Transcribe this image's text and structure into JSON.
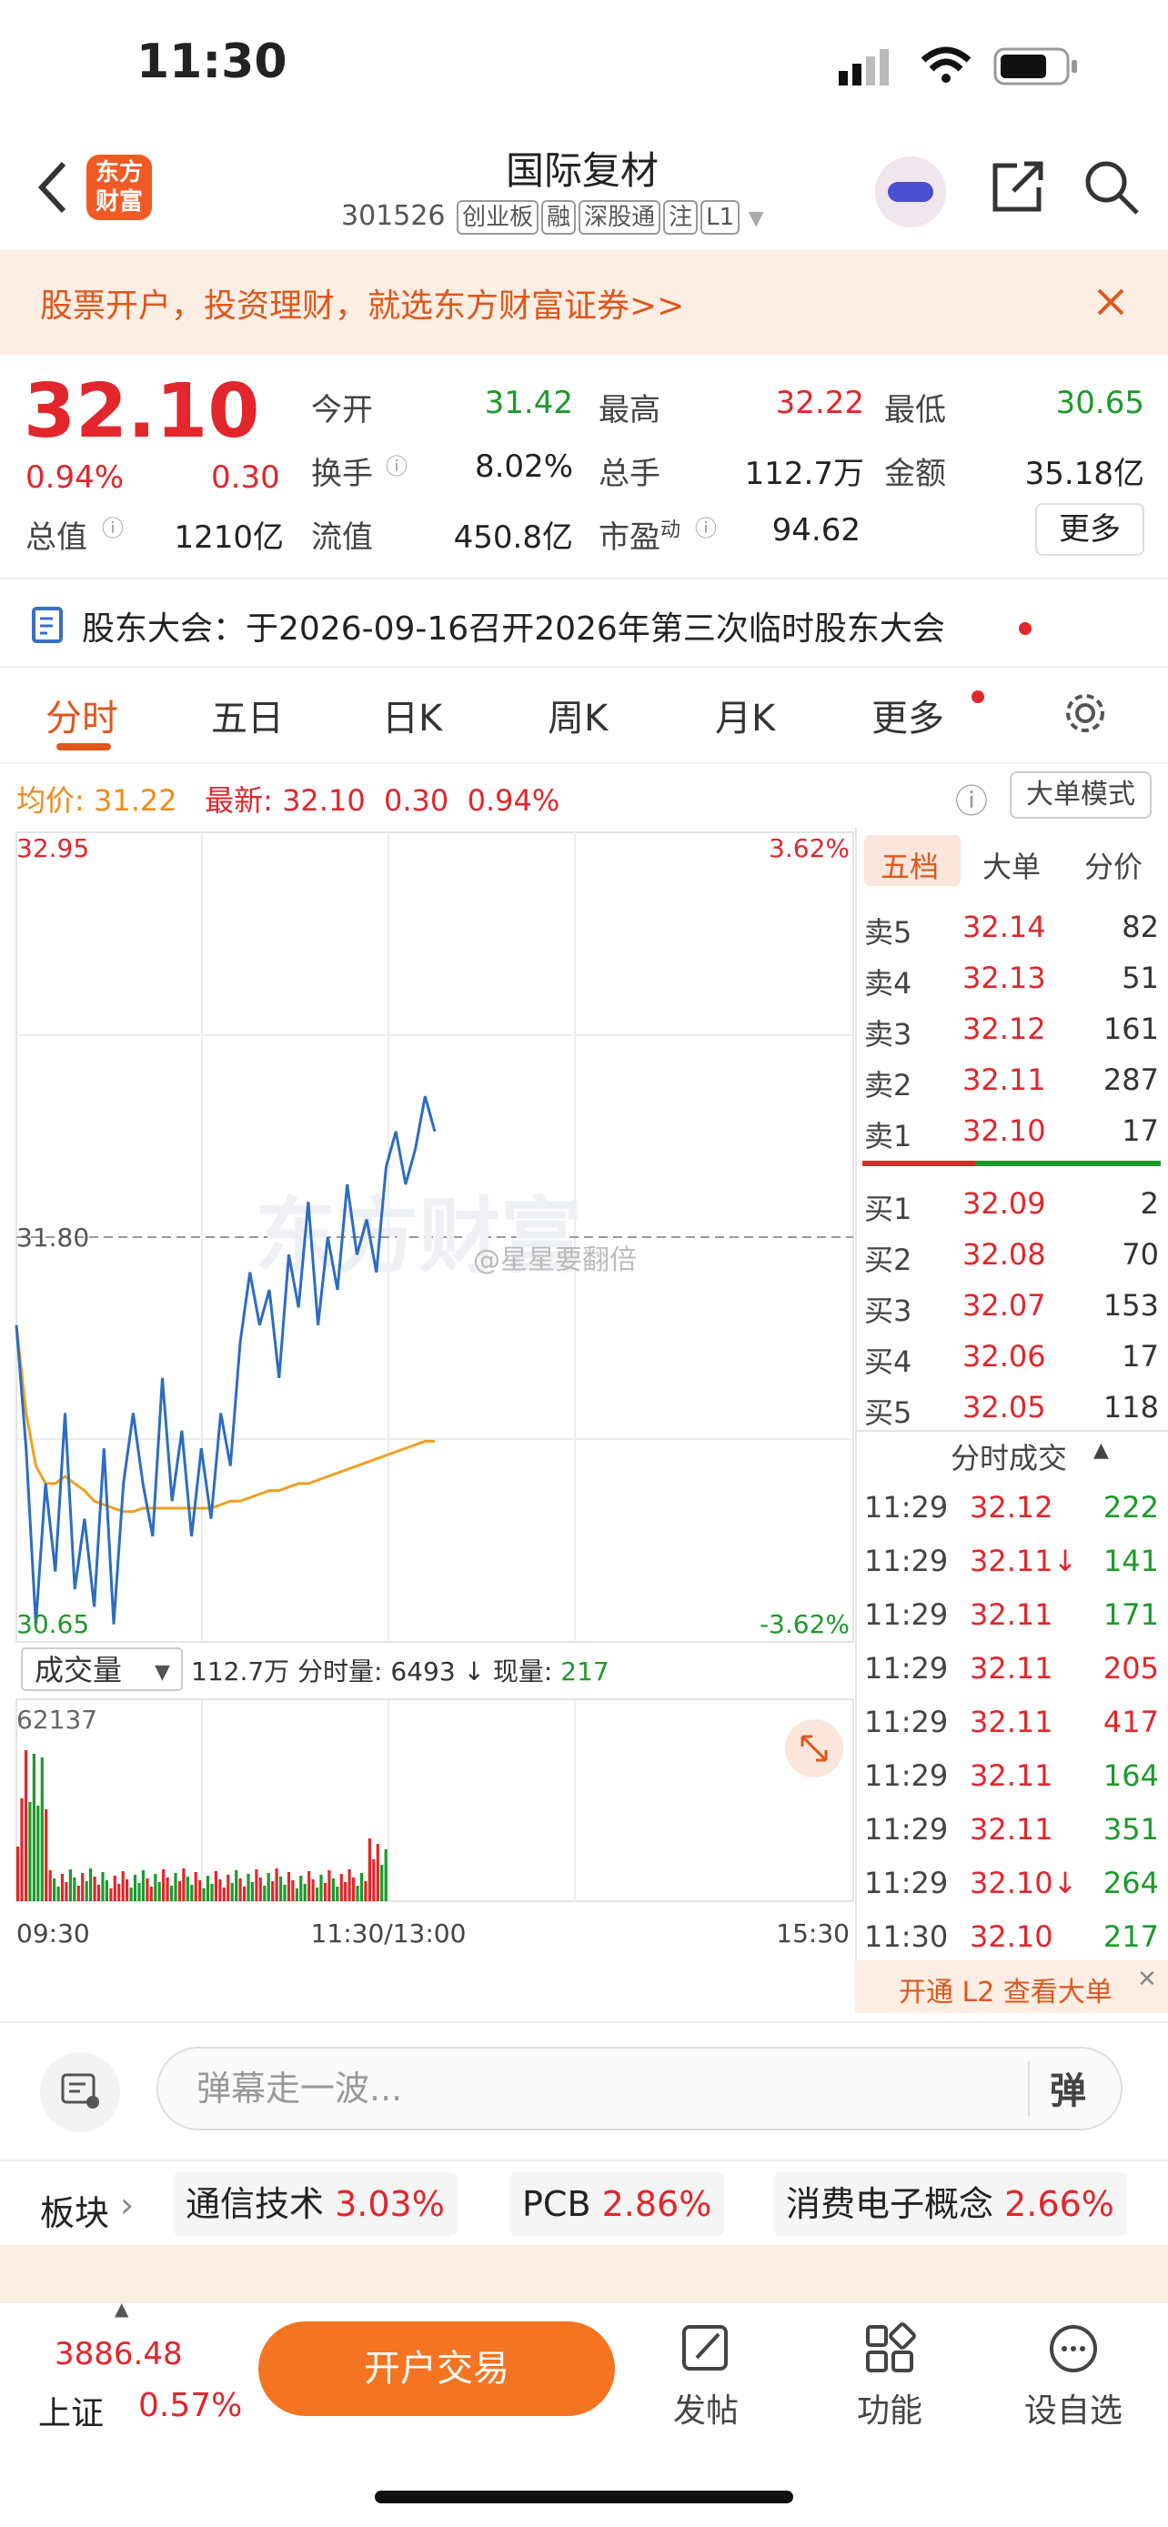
{
  "status": {
    "time": "11:30"
  },
  "header": {
    "logo_line1": "东方",
    "logo_line2": "财富",
    "name": "国际复材",
    "code": "301526",
    "tags": [
      "创业板",
      "融",
      "深股通",
      "注",
      "L1"
    ]
  },
  "banner": {
    "text": "股票开户，投资理财，就选东方财富证券>>"
  },
  "quote": {
    "price": "32.10",
    "change_pct": "0.94%",
    "change": "0.30",
    "open_label": "今开",
    "open": "31.42",
    "high_label": "最高",
    "high": "32.22",
    "low_label": "最低",
    "low": "30.65",
    "turnover_label": "换手",
    "turnover": "8.02%",
    "volume_label": "总手",
    "volume": "112.7万",
    "amount_label": "金额",
    "amount": "35.18亿",
    "total_cap_label": "总值",
    "total_cap": "1210亿",
    "float_cap_label": "流值",
    "float_cap": "450.8亿",
    "pe_label": "市盈",
    "pe_sup": "动",
    "pe": "94.62",
    "more": "更多"
  },
  "notice": {
    "text": "股东大会：于2026-09-16召开2026年第三次临时股东大会"
  },
  "tabs": [
    "分时",
    "五日",
    "日K",
    "周K",
    "月K",
    "更多"
  ],
  "infoline": {
    "avg_label": "均价:",
    "avg": "31.22",
    "latest_label": "最新:",
    "latest": "32.10",
    "chg": "0.30",
    "chg_pct": "0.94%",
    "bigorder_btn": "大单模式"
  },
  "chart_labels": {
    "y_top": "32.95",
    "y_mid": "31.80",
    "y_bottom": "30.65",
    "pct_top": "3.62%",
    "pct_bottom": "-3.62%",
    "vol_selector": "成交量",
    "vol_info": "112.7万  分时量: 6493 ↓ 现量:",
    "vol_now": "217",
    "vol_max": "62137",
    "x_start": "09:30",
    "x_mid": "11:30/13:00",
    "x_end": "15:30",
    "watermark": "东方财富",
    "weibo": "@星星要翻倍"
  },
  "chart_data": {
    "type": "line",
    "title": "",
    "x_range": [
      "09:30",
      "15:30"
    ],
    "ylim": [
      30.65,
      32.95
    ],
    "series": [
      {
        "name": "",
        "values": [
          31.55,
          31.2,
          30.7,
          31.1,
          30.85,
          31.3,
          30.8,
          31.0,
          30.75,
          31.2,
          30.7,
          31.1,
          31.3,
          31.1,
          30.95,
          31.4,
          31.05,
          31.25,
          30.95,
          31.2,
          31.0,
          31.3,
          31.15,
          31.5,
          31.7,
          31.55,
          31.65,
          31.4,
          31.75,
          31.6,
          31.9,
          31.55,
          31.8,
          31.65,
          31.95,
          31.75,
          31.85,
          31.7,
          32.0,
          32.1,
          31.95,
          32.05,
          32.2,
          32.1
        ]
      },
      {
        "name": "",
        "values": [
          31.55,
          31.3,
          31.15,
          31.1,
          31.1,
          31.12,
          31.1,
          31.08,
          31.05,
          31.04,
          31.03,
          31.02,
          31.02,
          31.03,
          31.03,
          31.03,
          31.03,
          31.03,
          31.03,
          31.03,
          31.03,
          31.04,
          31.05,
          31.05,
          31.06,
          31.07,
          31.08,
          31.08,
          31.09,
          31.1,
          31.1,
          31.11,
          31.12,
          31.13,
          31.14,
          31.15,
          31.16,
          31.17,
          31.18,
          31.19,
          31.2,
          31.21,
          31.22,
          31.22
        ]
      }
    ],
    "volume_max": 62137
  },
  "orderbook": {
    "tabs": [
      "五档",
      "大单",
      "分价"
    ],
    "asks": [
      {
        "label": "卖5",
        "price": "32.14",
        "qty": "82"
      },
      {
        "label": "卖4",
        "price": "32.13",
        "qty": "51"
      },
      {
        "label": "卖3",
        "price": "32.12",
        "qty": "161"
      },
      {
        "label": "卖2",
        "price": "32.11",
        "qty": "287"
      },
      {
        "label": "卖1",
        "price": "32.10",
        "qty": "17"
      }
    ],
    "bids": [
      {
        "label": "买1",
        "price": "32.09",
        "qty": "2"
      },
      {
        "label": "买2",
        "price": "32.08",
        "qty": "70"
      },
      {
        "label": "买3",
        "price": "32.07",
        "qty": "153"
      },
      {
        "label": "买4",
        "price": "32.06",
        "qty": "17"
      },
      {
        "label": "买5",
        "price": "32.05",
        "qty": "118"
      }
    ],
    "trades_title": "分时成交",
    "trades": [
      {
        "time": "11:29",
        "price": "32.12",
        "qty": "222",
        "dir": "green"
      },
      {
        "time": "11:29",
        "price": "32.11↓",
        "qty": "141",
        "dir": "green"
      },
      {
        "time": "11:29",
        "price": "32.11",
        "qty": "171",
        "dir": "green"
      },
      {
        "time": "11:29",
        "price": "32.11",
        "qty": "205",
        "dir": "red"
      },
      {
        "time": "11:29",
        "price": "32.11",
        "qty": "417",
        "dir": "red"
      },
      {
        "time": "11:29",
        "price": "32.11",
        "qty": "164",
        "dir": "green"
      },
      {
        "time": "11:29",
        "price": "32.11",
        "qty": "351",
        "dir": "green"
      },
      {
        "time": "11:29",
        "price": "32.10↓",
        "qty": "264",
        "dir": "green"
      },
      {
        "time": "11:30",
        "price": "32.10",
        "qty": "217",
        "dir": "green"
      }
    ],
    "l2_promo": "开通 L2 查看大单"
  },
  "danmu": {
    "placeholder": "弹幕走一波...",
    "btn": "弹"
  },
  "sectors": {
    "label": "板块",
    "items": [
      {
        "name": "通信技术",
        "pct": "3.03%"
      },
      {
        "name": "PCB",
        "pct": "2.86%"
      },
      {
        "name": "消费电子概念",
        "pct": "2.66%"
      }
    ]
  },
  "bottombar": {
    "index_value": "3886.48",
    "index_name": "上证",
    "index_pct": "0.57%",
    "trade": "开户交易",
    "post": "发帖",
    "func": "功能",
    "watch": "设自选"
  },
  "colors": {
    "up": "#e2262b",
    "down": "#1c9a2a",
    "accent": "#f15a22",
    "price_line": "#2d6cc0",
    "avg_line": "#f0a020"
  }
}
